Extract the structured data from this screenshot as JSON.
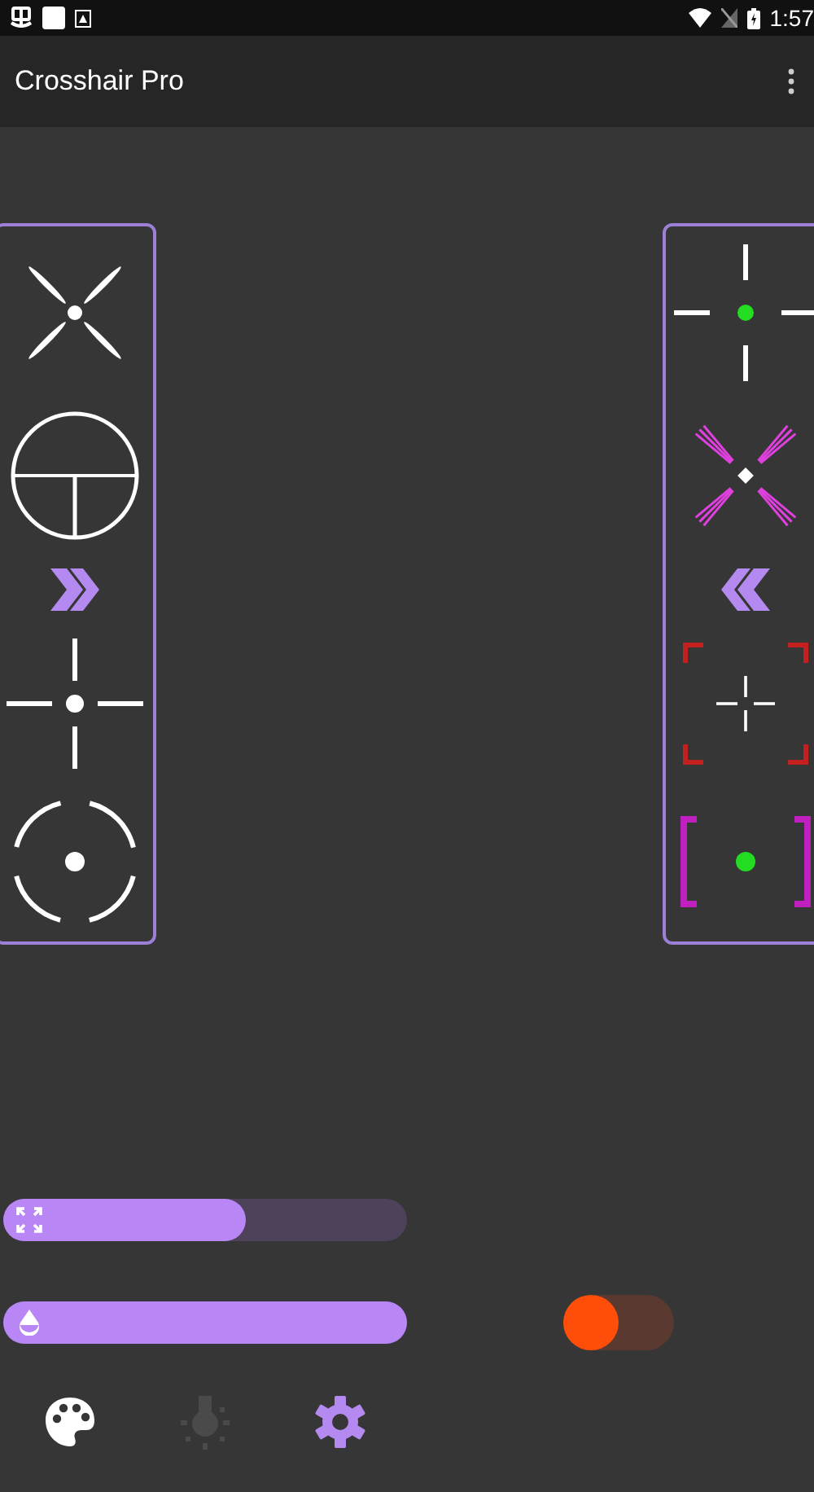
{
  "status_bar": {
    "time": "1:57"
  },
  "app_bar": {
    "title": "Crosshair Pro"
  },
  "left_panel": [
    {
      "kind": "x-dot"
    },
    {
      "kind": "scope"
    },
    {
      "kind": "chevron-right"
    },
    {
      "kind": "cross-dot"
    },
    {
      "kind": "circle-dot"
    }
  ],
  "right_panel": [
    {
      "kind": "cross-green"
    },
    {
      "kind": "burst"
    },
    {
      "kind": "chevron-left"
    },
    {
      "kind": "corners"
    },
    {
      "kind": "brackets"
    }
  ],
  "sliders": [
    {
      "kind": "size",
      "level": 0.6
    },
    {
      "kind": "opacity",
      "level": 1
    }
  ],
  "toggle": {
    "on": false
  },
  "nav": [
    {
      "kind": "palette",
      "selected": false,
      "disabled": false
    },
    {
      "kind": "bulb",
      "selected": false,
      "disabled": true
    },
    {
      "kind": "gear",
      "selected": true,
      "disabled": false
    }
  ]
}
